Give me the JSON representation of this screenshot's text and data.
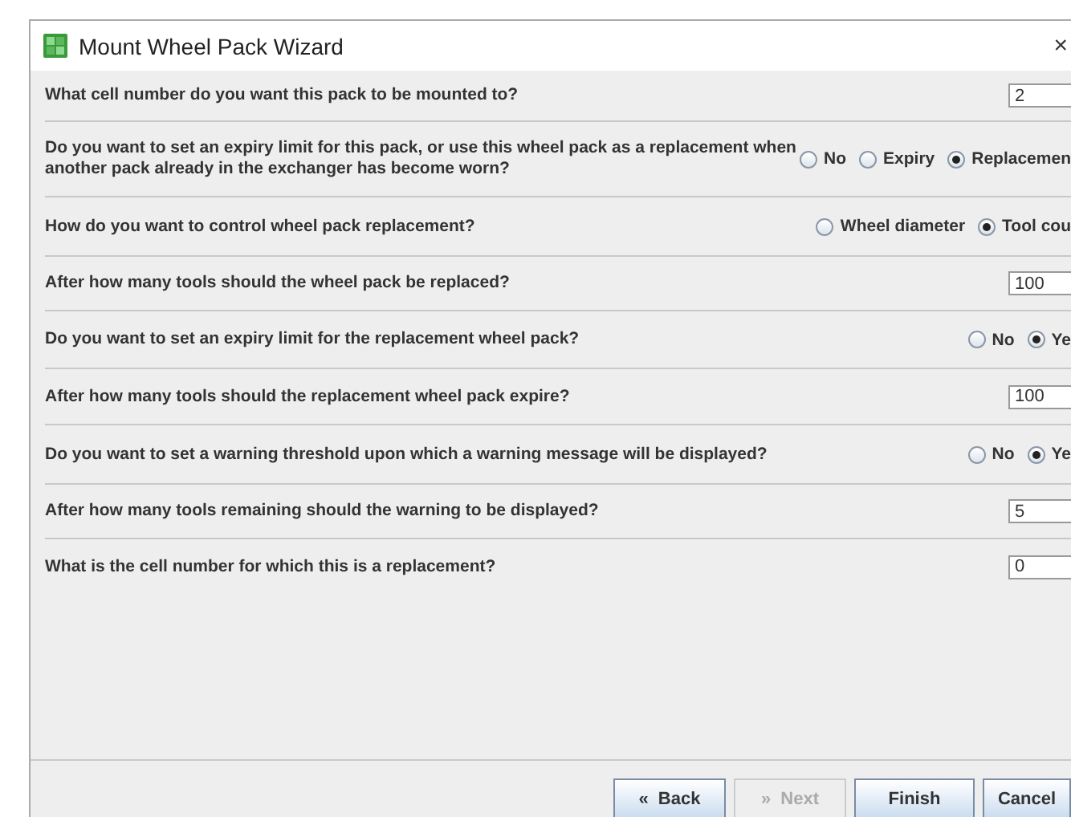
{
  "window": {
    "title": "Mount Wheel Pack Wizard",
    "close": "×"
  },
  "rows": [
    {
      "question": "What cell number do you want this pack to be mounted to?",
      "kind": "field",
      "value": "2"
    },
    {
      "question": "Do you want to set an expiry limit for this pack, or use this wheel pack as a replacement when another pack already in the exchanger has become worn?",
      "kind": "radio",
      "options": [
        {
          "label": "No",
          "selected": false
        },
        {
          "label": "Expiry",
          "selected": false
        },
        {
          "label": "Replacemen",
          "selected": true
        }
      ]
    },
    {
      "question": "How do you want to control wheel pack replacement?",
      "kind": "radio",
      "options": [
        {
          "label": "Wheel diameter",
          "selected": false
        },
        {
          "label": "Tool cou",
          "selected": true
        }
      ]
    },
    {
      "question": "After how many tools should the wheel pack be replaced?",
      "kind": "field",
      "value": "100"
    },
    {
      "question": "Do you want to set an expiry limit for the replacement wheel pack?",
      "kind": "radio",
      "options": [
        {
          "label": "No",
          "selected": false
        },
        {
          "label": "Ye",
          "selected": true
        }
      ]
    },
    {
      "question": "After how many tools should the replacement wheel pack expire?",
      "kind": "field",
      "value": "100"
    },
    {
      "question": "Do you want to set a warning threshold upon which a warning message will be displayed?",
      "kind": "radio",
      "options": [
        {
          "label": "No",
          "selected": false
        },
        {
          "label": "Ye",
          "selected": true
        }
      ]
    },
    {
      "question": "After how many tools remaining should the warning to be displayed?",
      "kind": "field",
      "value": "5"
    },
    {
      "question": "What is the cell number for which this is a replacement?",
      "kind": "field",
      "value": "0"
    }
  ],
  "buttons": [
    {
      "label": "Back",
      "icon": "«",
      "disabled": false
    },
    {
      "label": "Next",
      "icon": "»",
      "disabled": true
    },
    {
      "label": "Finish",
      "disabled": false
    },
    {
      "label": "Cancel",
      "disabled": false
    }
  ]
}
